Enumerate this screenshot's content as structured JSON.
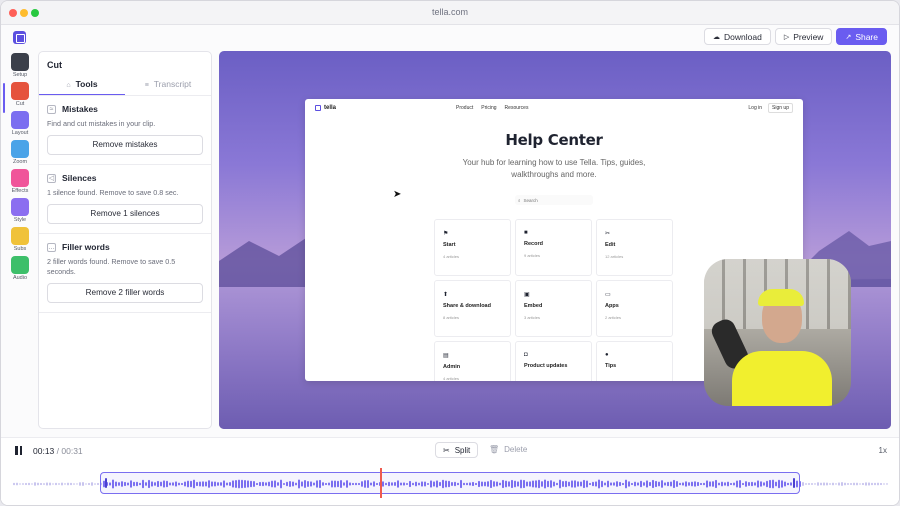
{
  "window": {
    "title": "tella.com"
  },
  "toolbar": {
    "download_label": "Download",
    "preview_label": "Preview",
    "share_label": "Share"
  },
  "rail": {
    "items": [
      {
        "label": "Setup",
        "color": "#3b3f4a"
      },
      {
        "label": "Cut",
        "color": "#e5533d"
      },
      {
        "label": "Layout",
        "color": "#7b6ef0"
      },
      {
        "label": "Zoom",
        "color": "#4aa3e8"
      },
      {
        "label": "Effects",
        "color": "#f0559a"
      },
      {
        "label": "Style",
        "color": "#8b6ef0"
      },
      {
        "label": "Subs",
        "color": "#f0c23a"
      },
      {
        "label": "Audio",
        "color": "#3dbf6a"
      }
    ]
  },
  "panel": {
    "title": "Cut",
    "tabs": [
      {
        "label": "Tools",
        "active": true
      },
      {
        "label": "Transcript",
        "active": false
      }
    ],
    "sections": [
      {
        "title": "Mistakes",
        "desc": "Find and cut mistakes in your clip.",
        "button": "Remove mistakes"
      },
      {
        "title": "Silences",
        "desc": "1 silence found. Remove to save 0.8 sec.",
        "button": "Remove 1 silences"
      },
      {
        "title": "Filler words",
        "desc": "2 filler words found. Remove to save 0.5 seconds.",
        "button": "Remove 2 filler words"
      }
    ]
  },
  "site": {
    "brand": "tella",
    "nav": [
      "Product",
      "Pricing",
      "Resources"
    ],
    "login": "Log in",
    "signup": "Sign up",
    "title": "Help Center",
    "subtitle": "Your hub for learning how to use Tella. Tips, guides, walkthroughs and more.",
    "search": "Search",
    "cards": [
      {
        "name": "Start",
        "count": "4 articles",
        "icon": "flag-icon"
      },
      {
        "name": "Record",
        "count": "9 articles",
        "icon": "video-icon"
      },
      {
        "name": "Edit",
        "count": "12 articles",
        "icon": "scissors-icon"
      },
      {
        "name": "Share & download",
        "count": "8 articles",
        "icon": "share-icon"
      },
      {
        "name": "Embed",
        "count": "3 articles",
        "icon": "embed-icon"
      },
      {
        "name": "Apps",
        "count": "2 articles",
        "icon": "monitor-icon"
      },
      {
        "name": "Admin",
        "count": "4 articles",
        "icon": "file-icon"
      },
      {
        "name": "Product updates",
        "count": "",
        "icon": "gift-icon"
      },
      {
        "name": "Tips",
        "count": "",
        "icon": "bulb-icon"
      }
    ]
  },
  "player": {
    "current": "00:13",
    "separator": " / ",
    "duration": "00:31",
    "split_label": "Split",
    "delete_label": "Delete",
    "speed": "1x",
    "progress": 0.4
  },
  "accent": "#6a5cf0"
}
